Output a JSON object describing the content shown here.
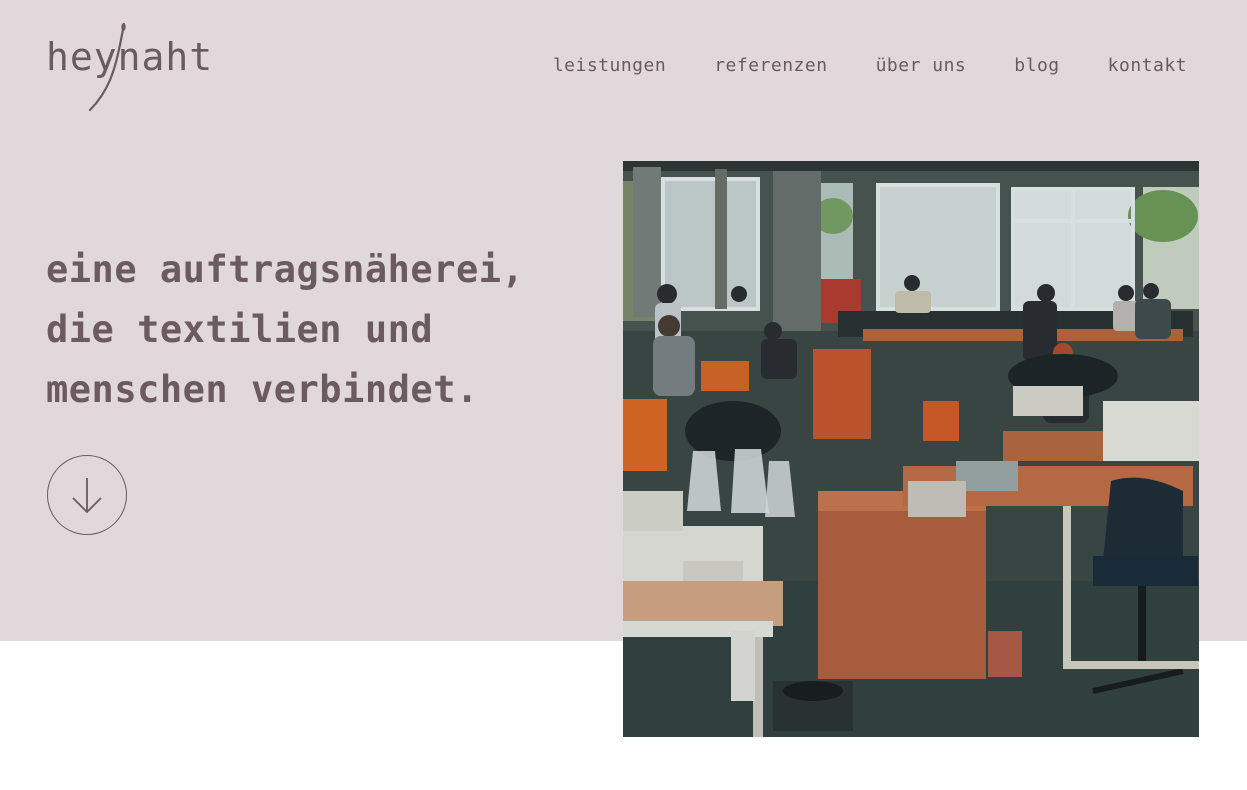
{
  "brand": {
    "name": "heynaht",
    "color": "#6b5a5f",
    "hero_background": "#e0d8da"
  },
  "nav": {
    "items": [
      {
        "label": "leistungen"
      },
      {
        "label": "referenzen"
      },
      {
        "label": "über uns"
      },
      {
        "label": "blog"
      },
      {
        "label": "kontakt"
      }
    ]
  },
  "hero": {
    "headline_lines": [
      "eine auftragsnäherei,",
      "die textilien und",
      "menschen verbindet."
    ],
    "scroll_icon": "arrow-down-icon",
    "photo_subject": "sewing workshop"
  }
}
